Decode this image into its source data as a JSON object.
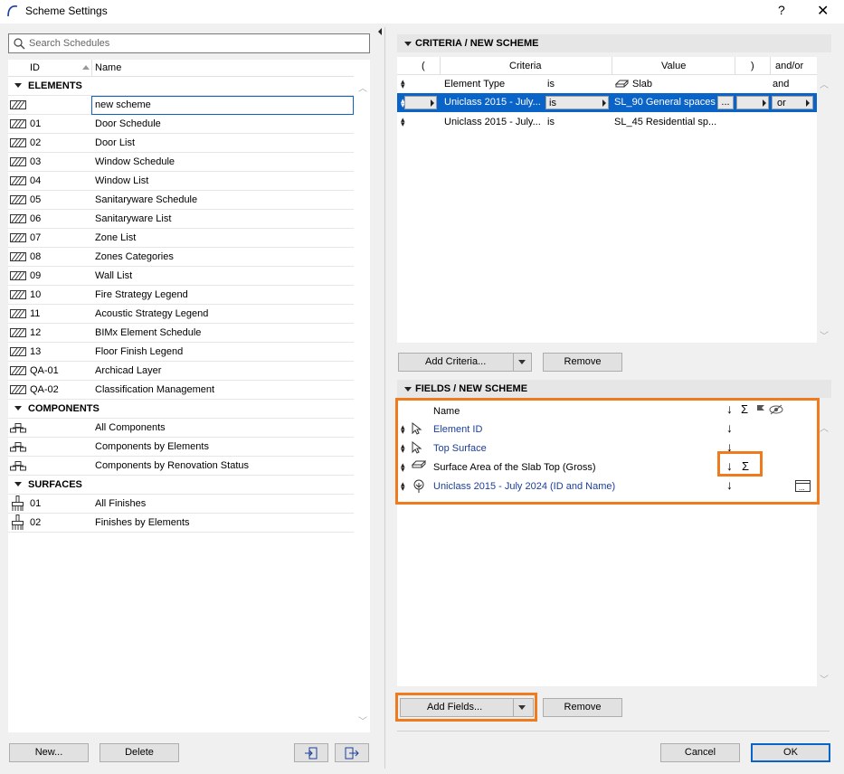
{
  "window": {
    "title": "Scheme Settings",
    "help": "?",
    "close": "✕"
  },
  "search": {
    "placeholder": "Search Schedules"
  },
  "list": {
    "col_id": "ID",
    "col_name": "Name",
    "groups": [
      {
        "label": "ELEMENTS",
        "items": [
          {
            "id": "",
            "name": "new scheme"
          },
          {
            "id": "01",
            "name": "Door Schedule"
          },
          {
            "id": "02",
            "name": "Door List"
          },
          {
            "id": "03",
            "name": "Window Schedule"
          },
          {
            "id": "04",
            "name": "Window List"
          },
          {
            "id": "05",
            "name": "Sanitaryware Schedule"
          },
          {
            "id": "06",
            "name": "Sanitaryware List"
          },
          {
            "id": "07",
            "name": "Zone List"
          },
          {
            "id": "08",
            "name": "Zones Categories"
          },
          {
            "id": "09",
            "name": "Wall List"
          },
          {
            "id": "10",
            "name": "Fire Strategy Legend"
          },
          {
            "id": "11",
            "name": "Acoustic Strategy Legend"
          },
          {
            "id": "12",
            "name": "BIMx Element Schedule"
          },
          {
            "id": "13",
            "name": "Floor Finish Legend"
          },
          {
            "id": "QA-01",
            "name": "Archicad Layer"
          },
          {
            "id": "QA-02",
            "name": "Classification Management"
          }
        ]
      },
      {
        "label": "COMPONENTS",
        "items": [
          {
            "id": "",
            "name": "All Components"
          },
          {
            "id": "",
            "name": "Components by Elements"
          },
          {
            "id": "",
            "name": "Components by Renovation Status"
          }
        ]
      },
      {
        "label": "SURFACES",
        "items": [
          {
            "id": "01",
            "name": "All Finishes"
          },
          {
            "id": "02",
            "name": "Finishes by Elements"
          }
        ]
      }
    ]
  },
  "left_buttons": {
    "new": "New...",
    "delete": "Delete"
  },
  "criteria": {
    "header": "CRITERIA /  NEW SCHEME",
    "cols": {
      "open": "(",
      "criteria": "Criteria",
      "value": "Value",
      "close": ")",
      "andor": "and/or"
    },
    "rows": [
      {
        "criteria": "Element Type",
        "op": "is",
        "value": "Slab",
        "andor": "and"
      },
      {
        "criteria": "Uniclass 2015 - July...",
        "op": "is",
        "value": "SL_90 General spaces",
        "more": "...",
        "andor": "or"
      },
      {
        "criteria": "Uniclass 2015 - July...",
        "op": "is",
        "value": "SL_45 Residential sp..."
      }
    ],
    "add": "Add Criteria...",
    "remove": "Remove"
  },
  "fields": {
    "header": "FIELDS /  NEW SCHEME",
    "col_name": "Name",
    "rows": [
      {
        "name": "Element ID",
        "sort": "↓",
        "sum": ""
      },
      {
        "name": "Top Surface",
        "sort": "↓",
        "sum": ""
      },
      {
        "name": "Surface Area of the Slab Top (Gross)",
        "sort": "↓",
        "sum": "Σ"
      },
      {
        "name": "Uniclass 2015 - July 2024 (ID and Name)",
        "sort": "↓",
        "sum": ""
      }
    ],
    "hdr_sort": "↓",
    "hdr_sum": "Σ",
    "add": "Add Fields...",
    "remove": "Remove"
  },
  "footer": {
    "cancel": "Cancel",
    "ok": "OK"
  },
  "colors": {
    "accent": "#f07b1f",
    "selection": "#0a64c8",
    "link": "#1a3e9a"
  }
}
